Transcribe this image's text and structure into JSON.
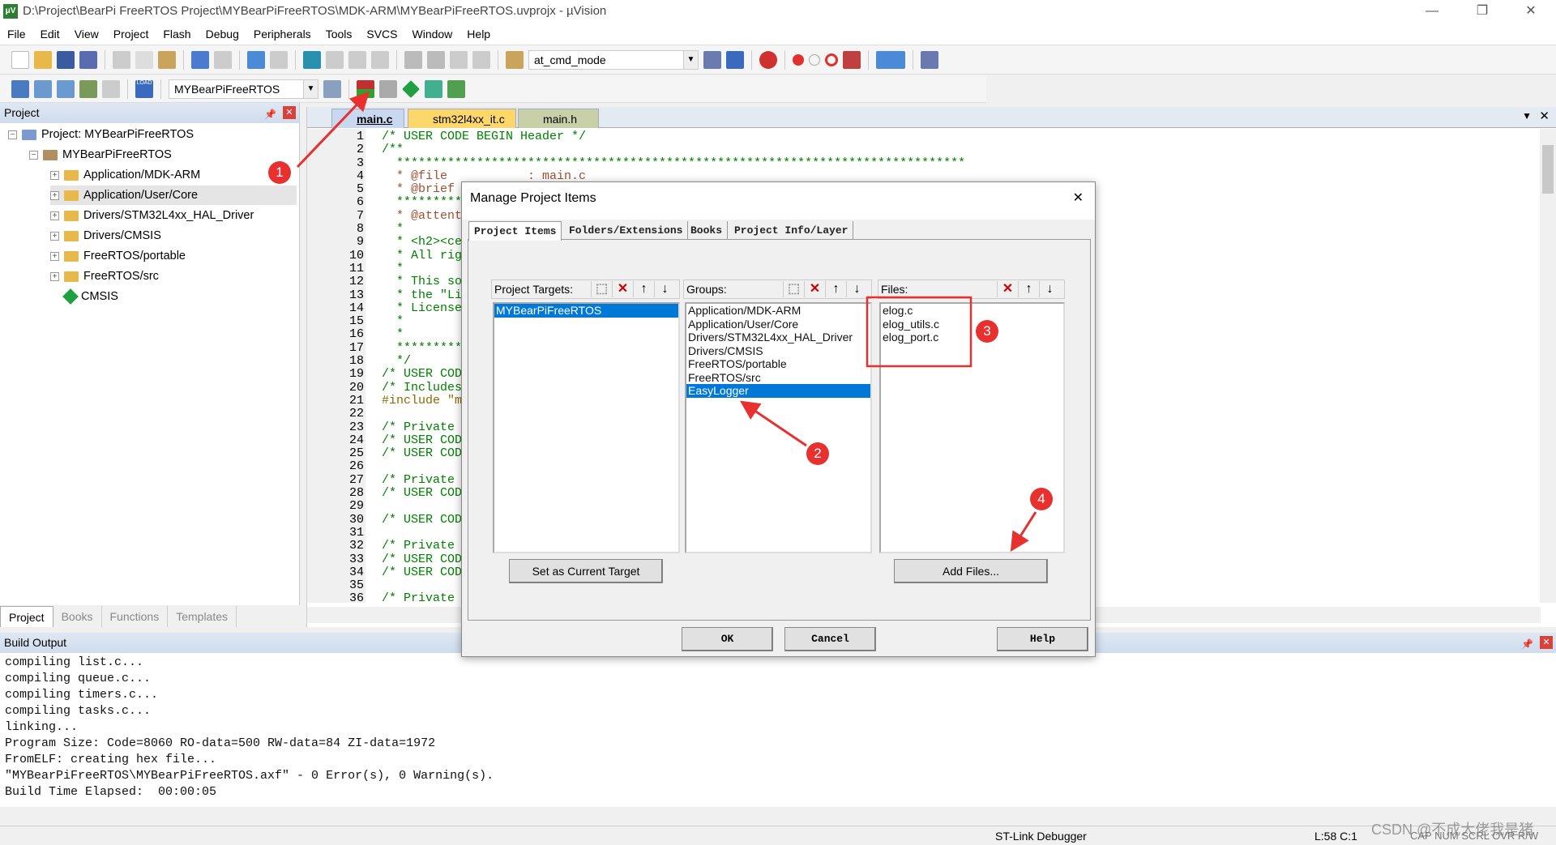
{
  "window": {
    "title": "D:\\Project\\BearPi FreeRTOS Project\\MYBearPiFreeRTOS\\MDK-ARM\\MYBearPiFreeRTOS.uvprojx - µVision",
    "minimize": "—",
    "restore": "❐",
    "close": "✕"
  },
  "menu": [
    "File",
    "Edit",
    "View",
    "Project",
    "Flash",
    "Debug",
    "Peripherals",
    "Tools",
    "SVCS",
    "Window",
    "Help"
  ],
  "toolbar": {
    "find_combo": "at_cmd_mode",
    "target_combo": "MYBearPiFreeRTOS",
    "load_label": "LOAD"
  },
  "project_panel": {
    "title": "Project",
    "root": "Project: MYBearPiFreeRTOS",
    "target": "MYBearPiFreeRTOS",
    "groups": [
      "Application/MDK-ARM",
      "Application/User/Core",
      "Drivers/STM32L4xx_HAL_Driver",
      "Drivers/CMSIS",
      "FreeRTOS/portable",
      "FreeRTOS/src"
    ],
    "cmsis": "CMSIS",
    "tabs": [
      "Project",
      "Books",
      "Functions",
      "Templates"
    ]
  },
  "editor": {
    "tabs": [
      "main.c",
      "stm32l4xx_it.c",
      "main.h"
    ],
    "lines": [
      "/* USER CODE BEGIN Header */",
      "/**",
      "  ******************************************************************************",
      "  * @file           : main.c",
      "  * @brief",
      "  *********",
      "  * @attent",
      "  *",
      "  * <h2><ce",
      "  * All rig",
      "  *",
      "  * This so",
      "  * the \"Li",
      "  * License",
      "  *",
      "  *",
      "  *********",
      "  */",
      "/* USER COD",
      "/* Includes",
      "#include \"m",
      "",
      "/* Private",
      "/* USER COD",
      "/* USER COD",
      "",
      "/* Private",
      "/* USER COD",
      "",
      "/* USER COD",
      "",
      "/* Private",
      "/* USER COD",
      "/* USER COD",
      "",
      "/* Private"
    ]
  },
  "build_output": {
    "title": "Build Output",
    "lines": [
      "compiling list.c...",
      "compiling queue.c...",
      "compiling timers.c...",
      "compiling tasks.c...",
      "linking...",
      "Program Size: Code=8060 RO-data=500 RW-data=84 ZI-data=1972",
      "FromELF: creating hex file...",
      "\"MYBearPiFreeRTOS\\MYBearPiFreeRTOS.axf\" - 0 Error(s), 0 Warning(s).",
      "Build Time Elapsed:  00:00:05"
    ]
  },
  "status": {
    "debugger": "ST-Link Debugger",
    "position": "L:58 C:1",
    "indicators": "CAP  NUM  SCRL  OVR  R/W",
    "watermark": "CSDN @不成大佬我是猪"
  },
  "dialog": {
    "title": "Manage Project Items",
    "close": "✕",
    "tabs": [
      "Project Items",
      "Folders/Extensions",
      "Books",
      "Project Info/Layer"
    ],
    "targets_label": "Project Targets:",
    "targets": [
      "MYBearPiFreeRTOS"
    ],
    "groups_label": "Groups:",
    "groups": [
      "Application/MDK-ARM",
      "Application/User/Core",
      "Drivers/STM32L4xx_HAL_Driver",
      "Drivers/CMSIS",
      "FreeRTOS/portable",
      "FreeRTOS/src",
      "EasyLogger"
    ],
    "selected_group": "EasyLogger",
    "files_label": "Files:",
    "files": [
      "elog.c",
      "elog_utils.c",
      "elog_port.c"
    ],
    "set_target_button": "Set as Current Target",
    "add_files_button": "Add Files...",
    "ok": "OK",
    "cancel": "Cancel",
    "help": "Help"
  },
  "annotations": [
    "1",
    "2",
    "3",
    "4"
  ],
  "colors": {
    "selection": "#0078d7",
    "annotation": "#e8302f",
    "comment": "#008000"
  }
}
